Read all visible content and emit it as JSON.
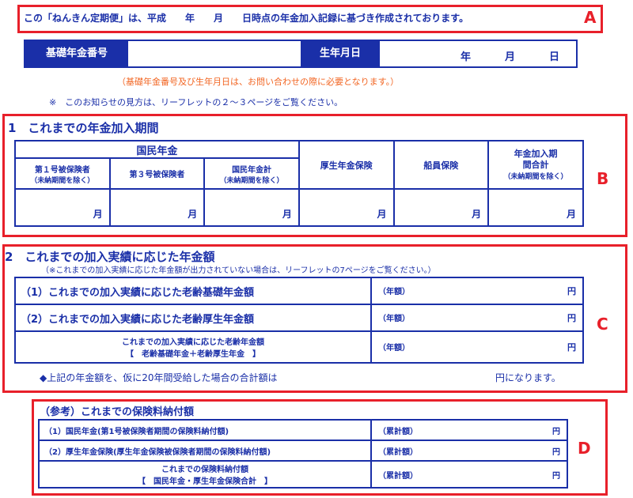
{
  "notice": {
    "header_text": "この「ねんきん定期便」は、平成　　年　　月　　日時点の年金加入記録に基づき作成されております。",
    "label_a": "A",
    "basic_number_label": "基礎年金番号",
    "birthdate_label": "生年月日",
    "birthdate_year": "年",
    "birthdate_month": "月",
    "birthdate_day": "日",
    "inquiry_note": "（基礎年金番号及び生年月日は、お問い合わせの際に必要となります。）",
    "leaflet_note": "※　このお知らせの見方は、リーフレットの２～３ページをご覧ください。"
  },
  "section1": {
    "title": "1　これまでの年金加入期間",
    "label_b": "B",
    "national_pension": "国民年金",
    "col_type1": "第１号被保険者",
    "col_type1_sub": "（未納期間を除く）",
    "col_type3": "第３号被保険者",
    "col_np_total": "国民年金計",
    "col_np_total_sub": "（未納期間を除く）",
    "col_employee": "厚生年金保険",
    "col_seamen": "船員保険",
    "col_total": "年金加入期間合計",
    "col_total_sub": "（未納期間を除く）",
    "unit_month": "月"
  },
  "section2": {
    "title": "2　これまでの加入実績に応じた年金額",
    "label_c": "C",
    "subnote": "（※これまでの加入実績に応じた年金額が出力されていない場合は、リーフレットの7ページをご覧ください。）",
    "row1": "（1）これまでの加入実績に応じた老齢基礎年金額",
    "row2": "（2）これまでの加入実績に応じた老齢厚生年金額",
    "row3_line1": "これまでの加入実績に応じた老齢年金額",
    "row3_line2": "【　老齢基礎年金＋老齢厚生年金　】",
    "annual": "（年額）",
    "yen": "円",
    "summary_left": "◆上記の年金額を、仮に20年間受給した場合の合計額は",
    "summary_right": "円になります。"
  },
  "section3": {
    "title": "（参考）これまでの保険料納付額",
    "label_d": "D",
    "row1": "（1）国民年金(第1号被保険者期間の保険料納付額)",
    "row2": "（2）厚生年金保険(厚生年金保険被保険者期間の保険料納付額)",
    "row3_line1": "これまでの保険料納付額",
    "row3_line2": "【　国民年金・厚生年金保険合計　】",
    "cumulative": "（累計額）",
    "yen": "円"
  }
}
